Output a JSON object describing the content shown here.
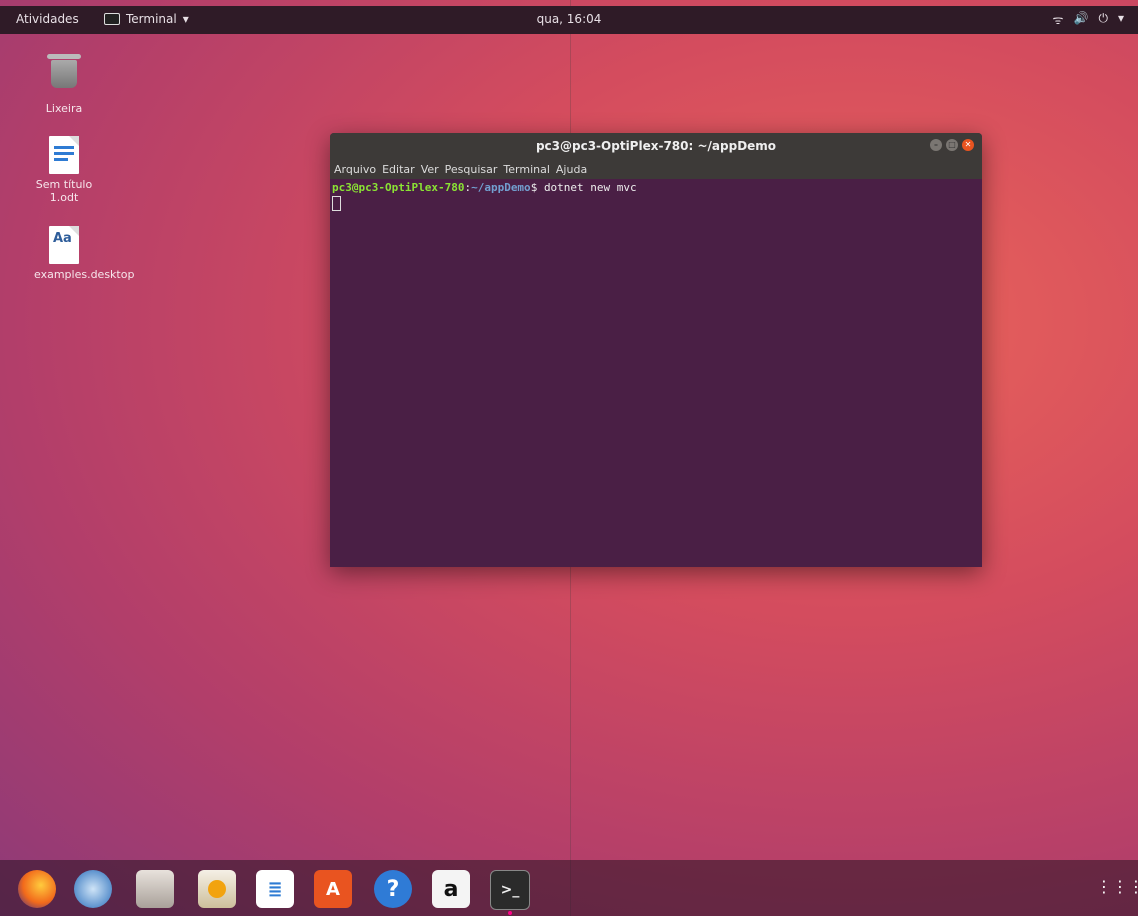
{
  "topbar": {
    "activities": "Atividades",
    "app_menu": "Terminal",
    "clock": "qua, 16:04",
    "status_icons": [
      "wifi-icon",
      "volume-icon",
      "power-icon"
    ]
  },
  "desktop_icons": [
    {
      "label": "Lixeira",
      "icon": "trash-icon"
    },
    {
      "label": "Sem título 1.odt",
      "icon": "document-icon"
    },
    {
      "label": "examples.desktop",
      "icon": "text-file-icon"
    }
  ],
  "terminal": {
    "title": "pc3@pc3-OptiPlex-780: ~/appDemo",
    "menu": [
      "Arquivo",
      "Editar",
      "Ver",
      "Pesquisar",
      "Terminal",
      "Ajuda"
    ],
    "prompt_user": "pc3@pc3-OptiPlex-780",
    "prompt_sep": ":",
    "prompt_path": "~/appDemo",
    "prompt_end": "$ ",
    "command": "dotnet new mvc"
  },
  "dock": [
    "firefox",
    "thunderbird",
    "files",
    "rhythmbox",
    "writer",
    "software-center",
    "help",
    "amazon",
    "terminal"
  ],
  "colors": {
    "accent": "#e95420",
    "terminal_bg": "#4a1f45"
  }
}
